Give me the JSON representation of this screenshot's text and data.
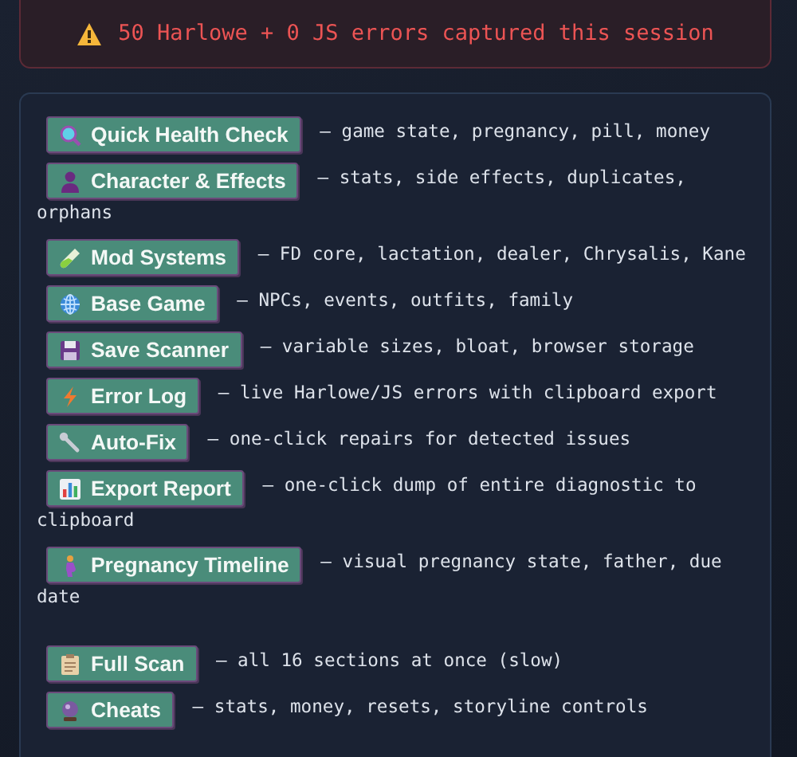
{
  "banner": {
    "text": "50 Harlowe + 0 JS errors captured this session"
  },
  "groups": [
    [
      {
        "label": "Quick Health Check",
        "description": "— game state, pregnancy, pill, money"
      },
      {
        "label": "Character & Effects",
        "description": "— stats, side effects, duplicates,",
        "continuation": "orphans"
      },
      {
        "label": "Mod Systems",
        "description": "— FD core, lactation, dealer, Chrysalis, Kane"
      },
      {
        "label": "Base Game",
        "description": "— NPCs, events, outfits, family"
      },
      {
        "label": "Save Scanner",
        "description": "— variable sizes, bloat, browser storage"
      },
      {
        "label": "Error Log",
        "description": "— live Harlowe/JS errors with clipboard export"
      },
      {
        "label": "Auto-Fix",
        "description": "— one-click repairs for detected issues"
      },
      {
        "label": "Export Report",
        "description": "— one-click dump of entire diagnostic to",
        "continuation": "clipboard"
      },
      {
        "label": "Pregnancy Timeline",
        "description": "— visual pregnancy state, father, due",
        "continuation": "date"
      }
    ],
    [
      {
        "label": "Full Scan",
        "description": "— all 16 sections at once (slow)"
      },
      {
        "label": "Cheats",
        "description": "— stats, money, resets, storyline controls"
      }
    ]
  ]
}
